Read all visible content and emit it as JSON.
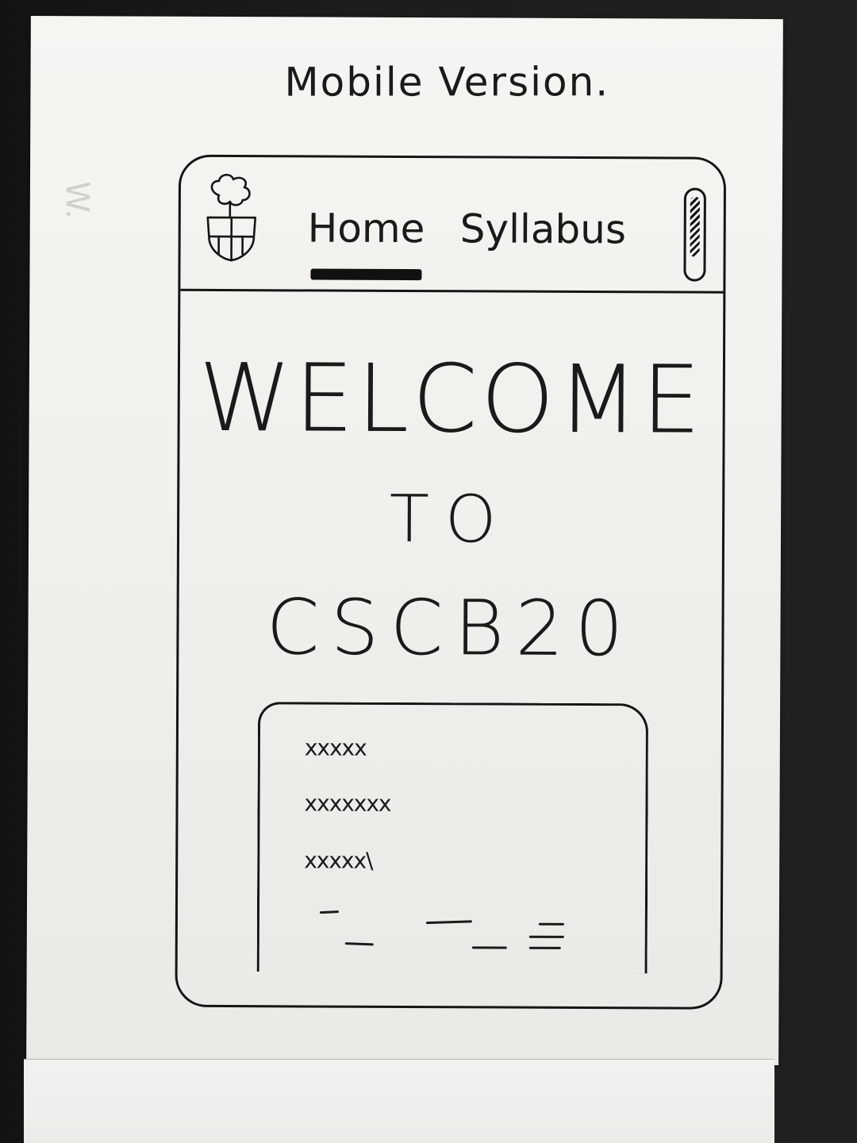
{
  "caption": "Mobile Version.",
  "bleed_through": "W.",
  "nav": {
    "logo": "tree-shield-logo-icon",
    "tabs": [
      {
        "label": "Home",
        "active": true
      },
      {
        "label": "Syllabus",
        "active": false
      }
    ],
    "menu_icon": "scrollbar-handle-icon"
  },
  "hero": {
    "line1": "WELCOME",
    "line2": "TO",
    "line3": "CSCB20"
  },
  "card": {
    "lines": [
      "xxxxx",
      "xxxxxxx",
      "xxxxx\\"
    ]
  },
  "colors": {
    "ink": "#151515",
    "paper": "#f3f2ef",
    "background": "#1d1b1a"
  }
}
